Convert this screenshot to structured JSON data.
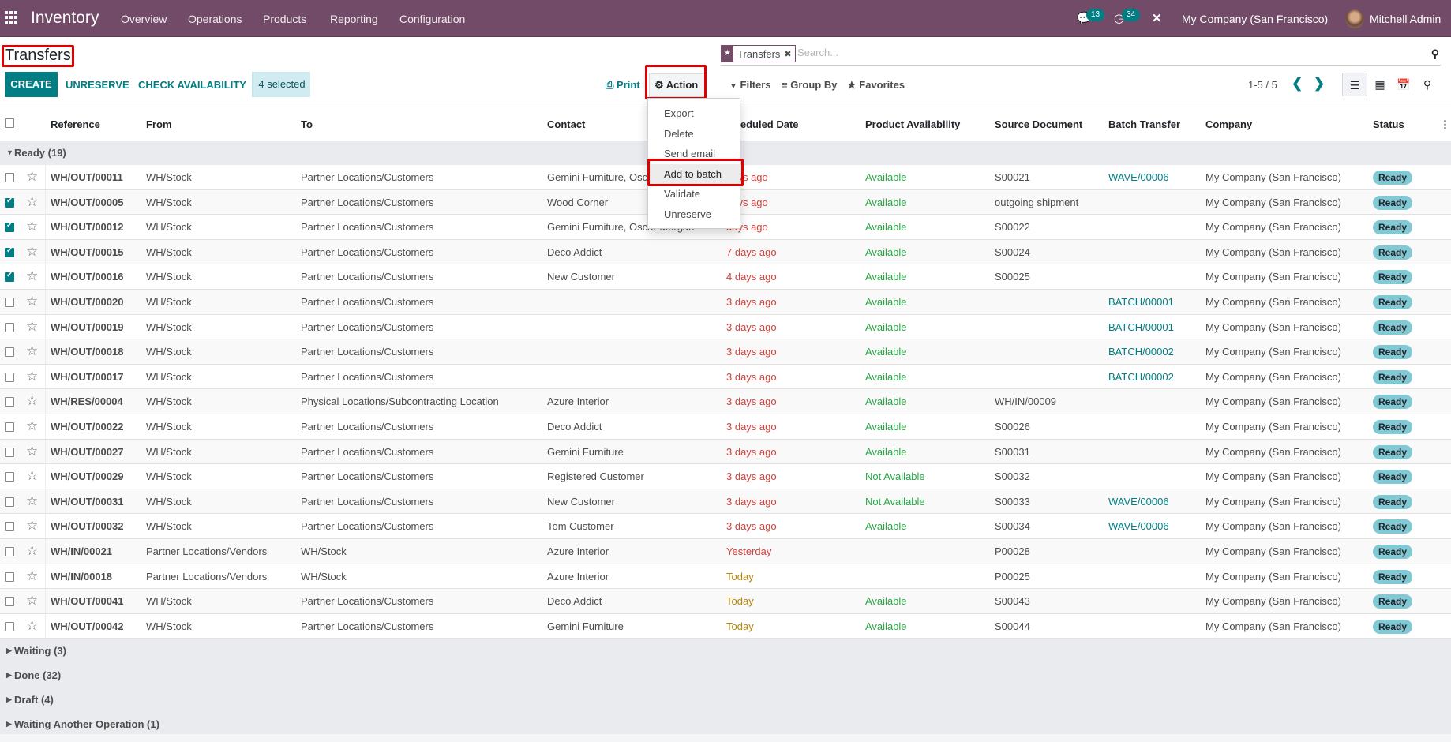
{
  "navbar": {
    "app_name": "Inventory",
    "menu": [
      "Overview",
      "Operations",
      "Products",
      "Reporting",
      "Configuration"
    ],
    "messages_count": "13",
    "activities_count": "34",
    "company": "My Company (San Francisco)",
    "user": "Mitchell Admin"
  },
  "control_panel": {
    "title": "Transfers",
    "create_label": "CREATE",
    "unreserve_label": "UNRESERVE",
    "check_availability_label": "CHECK AVAILABILITY",
    "selected_label": "4 selected",
    "print_label": "Print",
    "action_label": "Action",
    "filters_label": "Filters",
    "group_by_label": "Group By",
    "favorites_label": "Favorites",
    "pager": "1-5 / 5"
  },
  "search": {
    "facet_label": "Transfers",
    "placeholder": "Search..."
  },
  "action_menu": {
    "items": [
      "Export",
      "Delete",
      "Send email",
      "Add to batch",
      "Validate",
      "Unreserve"
    ],
    "highlighted": "Add to batch"
  },
  "table": {
    "columns": [
      "Reference",
      "From",
      "To",
      "Contact",
      "Scheduled Date",
      "Product Availability",
      "Source Document",
      "Batch Transfer",
      "Company",
      "Status"
    ],
    "groups": [
      {
        "label": "Ready (19)",
        "expanded": true
      },
      {
        "label": "Waiting (3)",
        "expanded": false
      },
      {
        "label": "Done (32)",
        "expanded": false
      },
      {
        "label": "Draft (4)",
        "expanded": false
      },
      {
        "label": "Waiting Another Operation (1)",
        "expanded": false
      }
    ],
    "rows": [
      {
        "checked": false,
        "ref": "WH/OUT/00011",
        "from": "WH/Stock",
        "to": "Partner Locations/Customers",
        "contact": "Gemini Furniture, Oscar Morgan",
        "date": "days ago",
        "date_state": "late",
        "avail": "Available",
        "source": "S00021",
        "batch": "WAVE/00006",
        "company": "My Company (San Francisco)",
        "status": "Ready"
      },
      {
        "checked": true,
        "ref": "WH/OUT/00005",
        "from": "WH/Stock",
        "to": "Partner Locations/Customers",
        "contact": "Wood Corner",
        "date": "days ago",
        "date_state": "late",
        "avail": "Available",
        "source": "outgoing shipment",
        "batch": "",
        "company": "My Company (San Francisco)",
        "status": "Ready"
      },
      {
        "checked": true,
        "ref": "WH/OUT/00012",
        "from": "WH/Stock",
        "to": "Partner Locations/Customers",
        "contact": "Gemini Furniture, Oscar Morgan",
        "date": "days ago",
        "date_state": "late",
        "avail": "Available",
        "source": "S00022",
        "batch": "",
        "company": "My Company (San Francisco)",
        "status": "Ready"
      },
      {
        "checked": true,
        "ref": "WH/OUT/00015",
        "from": "WH/Stock",
        "to": "Partner Locations/Customers",
        "contact": "Deco Addict",
        "date": "7 days ago",
        "date_state": "late",
        "avail": "Available",
        "source": "S00024",
        "batch": "",
        "company": "My Company (San Francisco)",
        "status": "Ready"
      },
      {
        "checked": true,
        "ref": "WH/OUT/00016",
        "from": "WH/Stock",
        "to": "Partner Locations/Customers",
        "contact": "New Customer",
        "date": "4 days ago",
        "date_state": "late",
        "avail": "Available",
        "source": "S00025",
        "batch": "",
        "company": "My Company (San Francisco)",
        "status": "Ready"
      },
      {
        "checked": false,
        "ref": "WH/OUT/00020",
        "from": "WH/Stock",
        "to": "Partner Locations/Customers",
        "contact": "",
        "date": "3 days ago",
        "date_state": "late",
        "avail": "Available",
        "source": "",
        "batch": "BATCH/00001",
        "company": "My Company (San Francisco)",
        "status": "Ready"
      },
      {
        "checked": false,
        "ref": "WH/OUT/00019",
        "from": "WH/Stock",
        "to": "Partner Locations/Customers",
        "contact": "",
        "date": "3 days ago",
        "date_state": "late",
        "avail": "Available",
        "source": "",
        "batch": "BATCH/00001",
        "company": "My Company (San Francisco)",
        "status": "Ready"
      },
      {
        "checked": false,
        "ref": "WH/OUT/00018",
        "from": "WH/Stock",
        "to": "Partner Locations/Customers",
        "contact": "",
        "date": "3 days ago",
        "date_state": "late",
        "avail": "Available",
        "source": "",
        "batch": "BATCH/00002",
        "company": "My Company (San Francisco)",
        "status": "Ready"
      },
      {
        "checked": false,
        "ref": "WH/OUT/00017",
        "from": "WH/Stock",
        "to": "Partner Locations/Customers",
        "contact": "",
        "date": "3 days ago",
        "date_state": "late",
        "avail": "Available",
        "source": "",
        "batch": "BATCH/00002",
        "company": "My Company (San Francisco)",
        "status": "Ready"
      },
      {
        "checked": false,
        "ref": "WH/RES/00004",
        "from": "WH/Stock",
        "to": "Physical Locations/Subcontracting Location",
        "contact": "Azure Interior",
        "date": "3 days ago",
        "date_state": "late",
        "avail": "Available",
        "source": "WH/IN/00009",
        "batch": "",
        "company": "My Company (San Francisco)",
        "status": "Ready"
      },
      {
        "checked": false,
        "ref": "WH/OUT/00022",
        "from": "WH/Stock",
        "to": "Partner Locations/Customers",
        "contact": "Deco Addict",
        "date": "3 days ago",
        "date_state": "late",
        "avail": "Available",
        "source": "S00026",
        "batch": "",
        "company": "My Company (San Francisco)",
        "status": "Ready"
      },
      {
        "checked": false,
        "ref": "WH/OUT/00027",
        "from": "WH/Stock",
        "to": "Partner Locations/Customers",
        "contact": "Gemini Furniture",
        "date": "3 days ago",
        "date_state": "late",
        "avail": "Available",
        "source": "S00031",
        "batch": "",
        "company": "My Company (San Francisco)",
        "status": "Ready"
      },
      {
        "checked": false,
        "ref": "WH/OUT/00029",
        "from": "WH/Stock",
        "to": "Partner Locations/Customers",
        "contact": "Registered Customer",
        "date": "3 days ago",
        "date_state": "late",
        "avail": "Not Available",
        "source": "S00032",
        "batch": "",
        "company": "My Company (San Francisco)",
        "status": "Ready"
      },
      {
        "checked": false,
        "ref": "WH/OUT/00031",
        "from": "WH/Stock",
        "to": "Partner Locations/Customers",
        "contact": "New Customer",
        "date": "3 days ago",
        "date_state": "late",
        "avail": "Not Available",
        "source": "S00033",
        "batch": "WAVE/00006",
        "company": "My Company (San Francisco)",
        "status": "Ready"
      },
      {
        "checked": false,
        "ref": "WH/OUT/00032",
        "from": "WH/Stock",
        "to": "Partner Locations/Customers",
        "contact": "Tom Customer",
        "date": "3 days ago",
        "date_state": "late",
        "avail": "Available",
        "source": "S00034",
        "batch": "WAVE/00006",
        "company": "My Company (San Francisco)",
        "status": "Ready"
      },
      {
        "checked": false,
        "ref": "WH/IN/00021",
        "from": "Partner Locations/Vendors",
        "to": "WH/Stock",
        "contact": "Azure Interior",
        "date": "Yesterday",
        "date_state": "late",
        "avail": "",
        "source": "P00028",
        "batch": "",
        "company": "My Company (San Francisco)",
        "status": "Ready"
      },
      {
        "checked": false,
        "ref": "WH/IN/00018",
        "from": "Partner Locations/Vendors",
        "to": "WH/Stock",
        "contact": "Azure Interior",
        "date": "Today",
        "date_state": "today",
        "avail": "",
        "source": "P00025",
        "batch": "",
        "company": "My Company (San Francisco)",
        "status": "Ready"
      },
      {
        "checked": false,
        "ref": "WH/OUT/00041",
        "from": "WH/Stock",
        "to": "Partner Locations/Customers",
        "contact": "Deco Addict",
        "date": "Today",
        "date_state": "today",
        "avail": "Available",
        "source": "S00043",
        "batch": "",
        "company": "My Company (San Francisco)",
        "status": "Ready"
      },
      {
        "checked": false,
        "ref": "WH/OUT/00042",
        "from": "WH/Stock",
        "to": "Partner Locations/Customers",
        "contact": "Gemini Furniture",
        "date": "Today",
        "date_state": "today",
        "avail": "Available",
        "source": "S00044",
        "batch": "",
        "company": "My Company (San Francisco)",
        "status": "Ready"
      }
    ]
  },
  "colors": {
    "brand": "#714b67",
    "primary": "#017e84",
    "late": "#d23f3a",
    "today": "#b8860b",
    "available": "#28a745",
    "status_ready": "#82c9d6",
    "highlight_box": "#e00000"
  }
}
